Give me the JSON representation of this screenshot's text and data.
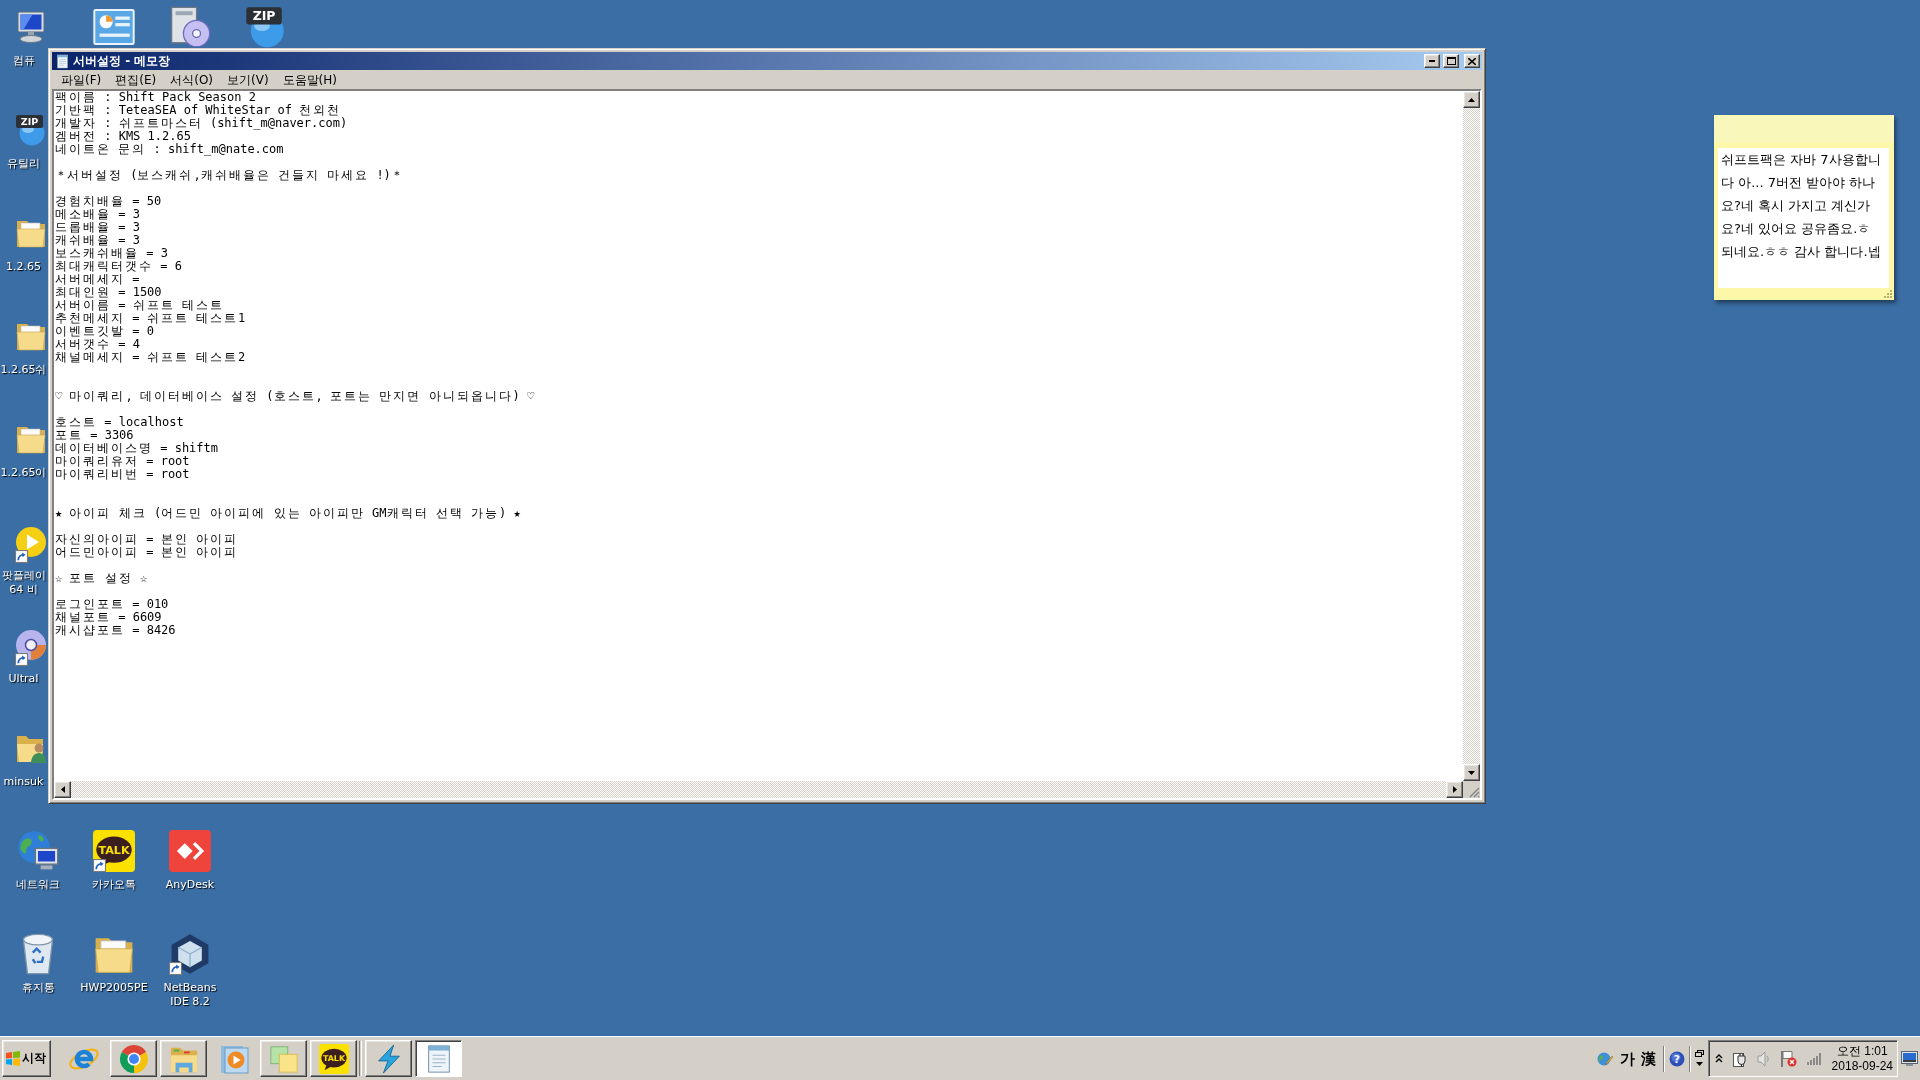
{
  "desktop_icons": [
    {
      "kind": "computer",
      "label": "컴퓨",
      "shortcut": false
    },
    {
      "kind": "dashboard",
      "shortcut": false
    },
    {
      "kind": "disc-box",
      "shortcut": false
    },
    {
      "kind": "zip",
      "icon_text": "ZIP",
      "shortcut": false
    },
    {
      "kind": "zip",
      "icon_text": "ZIP",
      "label": "유틸리",
      "shortcut": false
    },
    {
      "kind": "folder",
      "label": "1.2.65",
      "shortcut": false
    },
    {
      "kind": "folder",
      "label": "1.2.65쉬",
      "shortcut": false
    },
    {
      "kind": "folder",
      "label": "1.2.65이",
      "shortcut": false
    },
    {
      "kind": "player",
      "label": "팟플레이 64 비",
      "shortcut": true
    },
    {
      "kind": "disc",
      "label": "UltraI",
      "shortcut": true
    },
    {
      "kind": "user-folder",
      "label": "minsuk",
      "shortcut": false
    },
    {
      "kind": "network",
      "label": "네트워크",
      "shortcut": false
    },
    {
      "kind": "kakaotalk",
      "icon_text": "TALK",
      "label": "카카오톡",
      "shortcut": true
    },
    {
      "kind": "anydesk",
      "label": "AnyDesk",
      "shortcut": false
    },
    {
      "kind": "recycle-bin",
      "label": "휴지통",
      "shortcut": false
    },
    {
      "kind": "folder",
      "label": "HWP2005PE",
      "shortcut": false
    },
    {
      "kind": "netbeans",
      "label": "NetBeans IDE 8.2",
      "shortcut": true
    }
  ],
  "notepad": {
    "title": "서버설정 - 메모장",
    "menu": [
      "파일(F)",
      "편집(E)",
      "서식(O)",
      "보기(V)",
      "도움말(H)"
    ],
    "text": "팩이름 : Shift Pack Season 2\n기반팩 : TeteaSEA of WhiteStar of 천외천\n개발자 : 쉬프트마스터 (shift_m@naver.com)\n겜버전 : KMS 1.2.65\n네이트온 문의 : shift_m@nate.com\n\n＊서버설정 (보스캐쉬,캐쉬배율은 건들지 마세요 !)＊\n\n경험치배율 = 50\n메소배율 = 3\n드롭배율 = 3\n캐쉬배율 = 3\n보스캐쉬배율 = 3\n최대캐릭터갯수 = 6\n서버메세지 =\n최대인원 = 1500\n서버이름 = 쉬프트 테스트\n추천메세지 = 쉬프트 테스트1\n이벤트깃발 = 0\n서버갯수 = 4\n채널메세지 = 쉬프트 테스트2\n\n\n♡ 마이쿼리, 데이터베이스 설정 (호스트, 포트는 만지면 아니되옵니다) ♡\n\n호스트 = localhost\n포트 = 3306\n데이터베이스명 = shiftm\n마이쿼리유저 = root\n마이쿼리비번 = root\n\n\n★ 아이피 체크 (어드민 아이피에 있는 아이피만 GM캐릭터 선택 가능) ★\n\n자신의아이피 = 본인 아이피\n어드민아이피 = 본인 아이피\n\n☆ 포트 설정 ☆\n\n로그인포트 = 010\n채널포트 = 6609\n캐시샵포트 = 8426"
  },
  "sticky_note": {
    "text": "쉬프트팩은 자바 7사용합니다 아... 7버전 받아야 하나요?네 혹시 가지고 계신가요?네 있어요 공유좀요.ㅎ 되네요.ㅎㅎ 감사 합니다.넵"
  },
  "taskbar": {
    "start_button": {
      "label": "시작"
    },
    "launch_icons": [
      {
        "kind": "browser-e",
        "raised": false
      },
      {
        "kind": "browser-circle",
        "raised": true
      },
      {
        "kind": "explorer",
        "raised": true
      },
      {
        "kind": "media",
        "raised": false
      },
      {
        "kind": "sticky-notes",
        "raised": true
      },
      {
        "kind": "kakaotalk",
        "icon_text": "TALK",
        "raised": true
      }
    ],
    "window_buttons": [
      {
        "kind": "lightning",
        "selected": false
      },
      {
        "kind": "notepad",
        "selected": true
      }
    ],
    "language_bar": {
      "hangul_mode": "가",
      "hanja_mode": "漢",
      "help": "?"
    },
    "clock": {
      "time": "오전 1:01",
      "date": "2018-09-24"
    }
  }
}
